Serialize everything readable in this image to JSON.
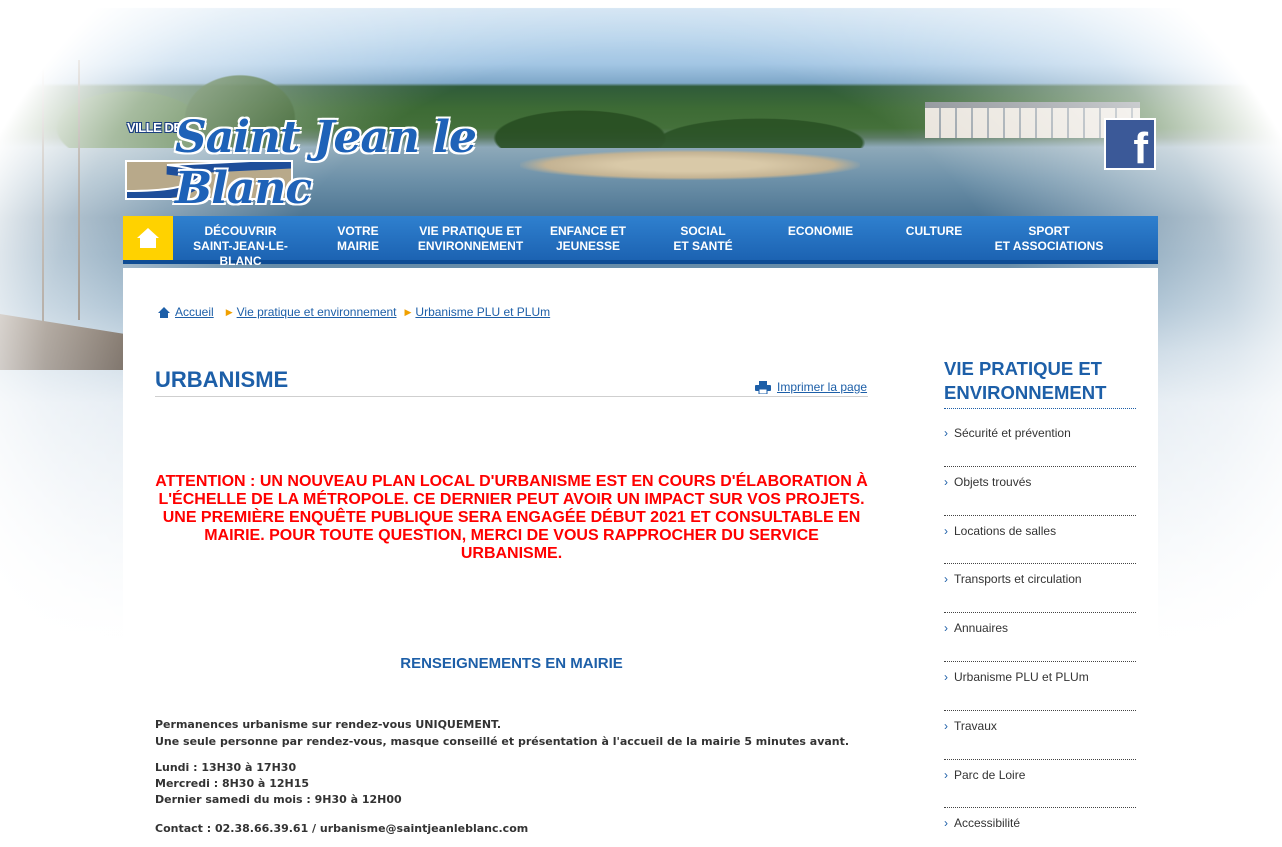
{
  "header": {
    "logo_prefix": "VILLE DE",
    "logo_name": "Saint Jean le Blanc",
    "facebook_label": "f"
  },
  "nav": {
    "home_icon": "home-icon",
    "items": [
      {
        "line1": "Découvrir",
        "line2": "Saint-Jean-le-Blanc"
      },
      {
        "line1": "Votre",
        "line2": "Mairie"
      },
      {
        "line1": "Vie pratique et",
        "line2": "environnement"
      },
      {
        "line1": "Enfance et",
        "line2": "jeunesse"
      },
      {
        "line1": "Social",
        "line2": "et santé"
      },
      {
        "line1": "Economie",
        "line2": ""
      },
      {
        "line1": "Culture",
        "line2": ""
      },
      {
        "line1": "Sport",
        "line2": "et associations"
      }
    ]
  },
  "breadcrumb": {
    "home_icon": "home-icon",
    "items": [
      "Accueil",
      "Vie pratique et environnement",
      "Urbanisme PLU et PLUm"
    ]
  },
  "main": {
    "title": "URBANISME",
    "print_label": "Imprimer la page",
    "alert": "ATTENTION : UN NOUVEAU PLAN LOCAL D'URBANISME EST EN COURS D'ÉLABORATION À L'ÉCHELLE DE LA MÉTROPOLE. CE DERNIER PEUT AVOIR UN IMPACT SUR VOS PROJETS. UNE PREMIÈRE ENQUÊTE PUBLIQUE SERA ENGAGÉE DÉBUT 2021 ET CONSULTABLE EN MAIRIE. POUR TOUTE QUESTION, MERCI DE VOUS RAPPROCHER DU SERVICE URBANISME.",
    "section_title": "RENSEIGNEMENTS EN MAIRIE",
    "permanence_line1": "Permanences urbanisme sur rendez-vous UNIQUEMENT.",
    "permanence_line2": "Une seule personne par rendez-vous, masque conseillé et présentation à l'accueil de la mairie 5 minutes avant.",
    "hours": [
      "Lundi : 13H30 à 17H30",
      "Mercredi : 8H30 à 12H15",
      "Dernier samedi du mois : 9H30 à 12H00"
    ],
    "contact": "Contact : 02.38.66.39.61 / urbanisme@saintjeanleblanc.com"
  },
  "sidebar": {
    "title": "VIE PRATIQUE ET ENVIRONNEMENT",
    "items": [
      "Sécurité et prévention",
      "Objets trouvés",
      "Locations de salles",
      "Transports et circulation",
      "Annuaires",
      "Urbanisme PLU et PLUm",
      "Travaux",
      "Parc de Loire",
      "Accessibilité"
    ]
  },
  "colors": {
    "brand_blue": "#1d5fa8",
    "nav_blue": "#2f80cf",
    "home_yellow": "#ffd200",
    "alert_red": "#ff0000",
    "facebook_blue": "#3b5998"
  }
}
